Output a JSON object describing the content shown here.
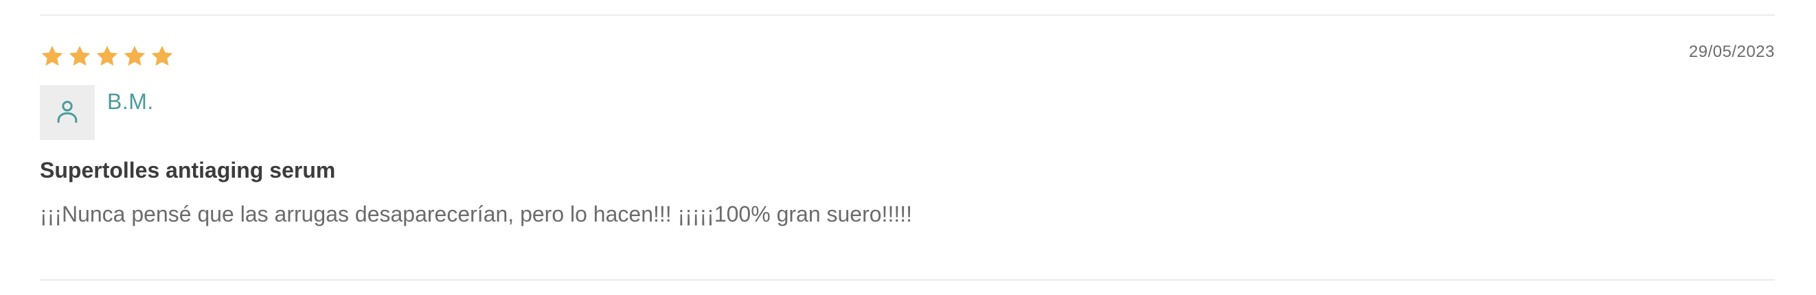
{
  "review": {
    "rating": 5,
    "max_rating": 5,
    "star_color": "#f5b14a",
    "date": "29/05/2023",
    "author": "B.M.",
    "avatar_icon": "user-icon",
    "title": "Supertolles antiaging serum",
    "text": "¡¡¡Nunca pensé que las arrugas desaparecerían, pero lo hacen!!! ¡¡¡¡¡100% gran suero!!!!!"
  },
  "colors": {
    "accent": "#4a9a9a",
    "divider": "#ebebeb"
  }
}
